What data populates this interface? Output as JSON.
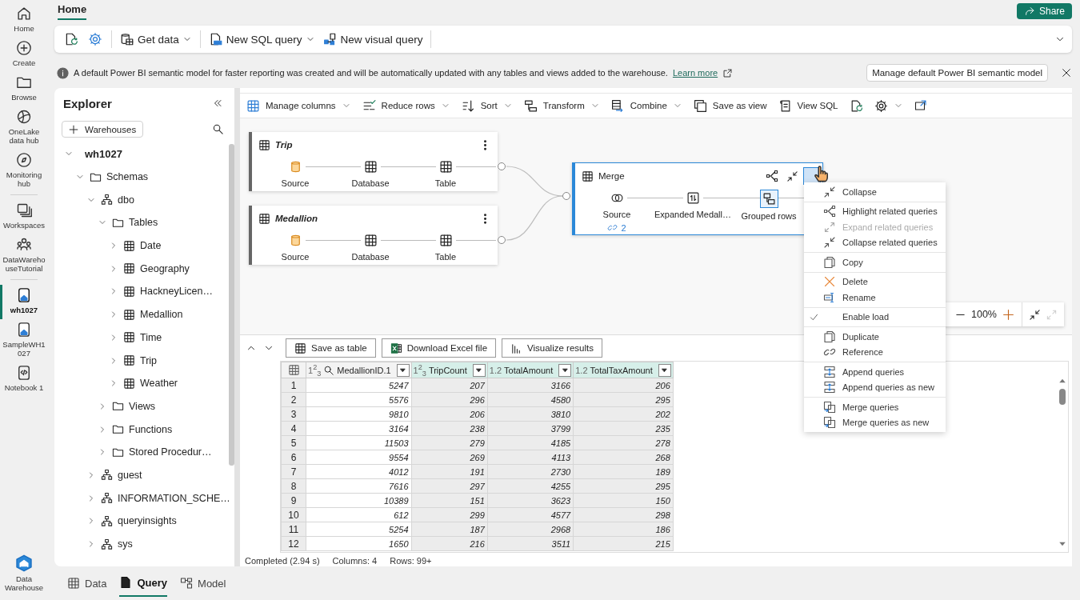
{
  "rail": {
    "groups": [
      [
        {
          "label": "Home",
          "selected": false
        },
        {
          "label": "Create",
          "selected": false
        },
        {
          "label": "Browse",
          "selected": false
        },
        {
          "label": "OneLake data hub",
          "selected": false
        },
        {
          "label": "Monitoring hub",
          "selected": false
        }
      ],
      [
        {
          "label": "Workspaces",
          "selected": false
        },
        {
          "label": "DataWarehouseTutorial",
          "selected": false
        }
      ],
      [
        {
          "label": "wh1027",
          "selected": true
        },
        {
          "label": "SampleWH1027",
          "selected": false
        },
        {
          "label": "Notebook 1",
          "selected": false
        }
      ]
    ],
    "footer": "Data Warehouse"
  },
  "ribbon": {
    "tab": "Home",
    "share": "Share",
    "buttons": [
      {
        "label": "Get data",
        "dropdown": true
      },
      {
        "label": "New SQL query",
        "dropdown": true
      },
      {
        "label": "New visual query",
        "dropdown": false
      }
    ]
  },
  "info_bar": {
    "message": "A default Power BI semantic model for faster reporting was created and will be automatically updated with any tables and views added to the warehouse.",
    "link": "Learn more",
    "button": "Manage default Power BI semantic model"
  },
  "explorer": {
    "title": "Explorer",
    "add_button": "Warehouses",
    "tree": [
      {
        "label": "wh1027",
        "kind": "warehouse",
        "expanded": true,
        "children": [
          {
            "label": "Schemas",
            "kind": "folder",
            "expanded": true,
            "children": [
              {
                "label": "dbo",
                "kind": "schema",
                "expanded": true,
                "children": [
                  {
                    "label": "Tables",
                    "kind": "folder",
                    "expanded": true,
                    "children": [
                      {
                        "label": "Date",
                        "kind": "table",
                        "expanded": false
                      },
                      {
                        "label": "Geography",
                        "kind": "table",
                        "expanded": false
                      },
                      {
                        "label": "HackneyLicen…",
                        "kind": "table",
                        "expanded": false
                      },
                      {
                        "label": "Medallion",
                        "kind": "table",
                        "expanded": false
                      },
                      {
                        "label": "Time",
                        "kind": "table",
                        "expanded": false
                      },
                      {
                        "label": "Trip",
                        "kind": "table",
                        "expanded": false
                      },
                      {
                        "label": "Weather",
                        "kind": "table",
                        "expanded": false
                      }
                    ]
                  },
                  {
                    "label": "Views",
                    "kind": "folder",
                    "expanded": false
                  },
                  {
                    "label": "Functions",
                    "kind": "folder",
                    "expanded": false
                  },
                  {
                    "label": "Stored Procedur…",
                    "kind": "folder",
                    "expanded": false
                  }
                ]
              },
              {
                "label": "guest",
                "kind": "schema",
                "expanded": false
              },
              {
                "label": "INFORMATION_SCHE…",
                "kind": "schema",
                "expanded": false
              },
              {
                "label": "queryinsights",
                "kind": "schema",
                "expanded": false
              },
              {
                "label": "sys",
                "kind": "schema",
                "expanded": false
              }
            ]
          }
        ]
      }
    ]
  },
  "editor_toolbar": [
    {
      "label": "Manage columns",
      "dropdown": true
    },
    {
      "label": "Reduce rows",
      "dropdown": true
    },
    {
      "label": "Sort",
      "dropdown": true
    },
    {
      "label": "Transform",
      "dropdown": true
    },
    {
      "label": "Combine",
      "dropdown": true
    },
    {
      "label": "Save as view",
      "dropdown": false
    },
    {
      "label": "View SQL",
      "dropdown": false
    }
  ],
  "diagram": {
    "queries": [
      {
        "title": "Trip",
        "load_enabled": false,
        "steps": [
          {
            "label": "Source",
            "kind": "source",
            "selected": false
          },
          {
            "label": "Database",
            "kind": "navigation",
            "selected": false
          },
          {
            "label": "Table",
            "kind": "navigation",
            "selected": false
          }
        ]
      },
      {
        "title": "Medallion",
        "load_enabled": false,
        "steps": [
          {
            "label": "Source",
            "kind": "source",
            "selected": false
          },
          {
            "label": "Database",
            "kind": "navigation",
            "selected": false
          },
          {
            "label": "Table",
            "kind": "navigation",
            "selected": false
          }
        ]
      }
    ],
    "merge": {
      "title": "Merge",
      "load_enabled": true,
      "badge": "2",
      "steps": [
        {
          "label": "Source",
          "kind": "merge",
          "selected": false
        },
        {
          "label": "Expanded Medall…",
          "kind": "expand",
          "selected": false
        },
        {
          "label": "Grouped rows",
          "kind": "group",
          "selected": true
        }
      ]
    },
    "zoom": "100%"
  },
  "context_menu": {
    "groups": [
      [
        {
          "label": "Collapse",
          "disabled": false,
          "checked": false
        }
      ],
      [
        {
          "label": "Highlight related queries",
          "disabled": false,
          "checked": false
        },
        {
          "label": "Expand related queries",
          "disabled": true,
          "checked": false
        },
        {
          "label": "Collapse related queries",
          "disabled": false,
          "checked": false
        }
      ],
      [
        {
          "label": "Copy",
          "disabled": false,
          "checked": false
        }
      ],
      [
        {
          "label": "Delete",
          "disabled": false,
          "checked": false
        },
        {
          "label": "Rename",
          "disabled": false,
          "checked": false
        }
      ],
      [
        {
          "label": "Enable load",
          "disabled": false,
          "checked": true
        }
      ],
      [
        {
          "label": "Duplicate",
          "disabled": false,
          "checked": false
        },
        {
          "label": "Reference",
          "disabled": false,
          "checked": false
        }
      ],
      [
        {
          "label": "Append queries",
          "disabled": false,
          "checked": false
        },
        {
          "label": "Append queries as new",
          "disabled": false,
          "checked": false
        }
      ],
      [
        {
          "label": "Merge queries",
          "disabled": false,
          "checked": false
        },
        {
          "label": "Merge queries as new",
          "disabled": false,
          "checked": false
        }
      ]
    ]
  },
  "results": {
    "buttons": [
      "Save as table",
      "Download Excel file",
      "Visualize results"
    ],
    "columns": [
      {
        "type": "1$^{2}$$_{3}$",
        "name": "MedallionID.1",
        "key": true,
        "selected": false
      },
      {
        "type": "1$^{2}$$_{3}$",
        "name": "TripCount",
        "key": false,
        "selected": true
      },
      {
        "type": "1.2",
        "name": "TotalAmount",
        "key": false,
        "selected": true
      },
      {
        "type": "1.2",
        "name": "TotalTaxAmount",
        "key": false,
        "selected": true
      }
    ],
    "rows": [
      {
        "number": "1",
        "cells": [
          "5247",
          "207",
          "3166",
          "206"
        ]
      },
      {
        "number": "2",
        "cells": [
          "5576",
          "296",
          "4580",
          "295"
        ]
      },
      {
        "number": "3",
        "cells": [
          "9810",
          "206",
          "3810",
          "202"
        ]
      },
      {
        "number": "4",
        "cells": [
          "3164",
          "238",
          "3799",
          "235"
        ]
      },
      {
        "number": "5",
        "cells": [
          "11503",
          "279",
          "4185",
          "278"
        ]
      },
      {
        "number": "6",
        "cells": [
          "9554",
          "269",
          "4113",
          "268"
        ]
      },
      {
        "number": "7",
        "cells": [
          "4012",
          "191",
          "2730",
          "189"
        ]
      },
      {
        "number": "8",
        "cells": [
          "7616",
          "297",
          "4255",
          "295"
        ]
      },
      {
        "number": "9",
        "cells": [
          "10389",
          "151",
          "3623",
          "150"
        ]
      },
      {
        "number": "10",
        "cells": [
          "612",
          "299",
          "4577",
          "298"
        ]
      },
      {
        "number": "11",
        "cells": [
          "5254",
          "187",
          "2968",
          "186"
        ]
      },
      {
        "number": "12",
        "cells": [
          "1650",
          "216",
          "3511",
          "215"
        ]
      }
    ]
  },
  "status": [
    "Completed (2.94 s)",
    "Columns: 4",
    "Rows: 99+"
  ],
  "bottom_tabs": [
    {
      "label": "Data",
      "selected": false
    },
    {
      "label": "Query",
      "selected": true
    },
    {
      "label": "Model",
      "selected": false
    }
  ]
}
